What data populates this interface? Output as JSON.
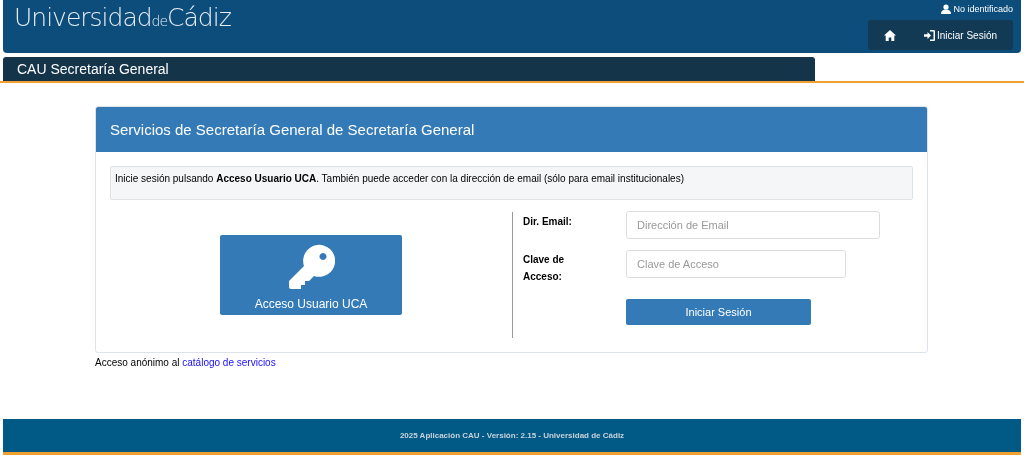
{
  "header": {
    "logo": [
      "Universidad",
      "de",
      "Cádiz"
    ],
    "user_status": "No identificado",
    "nav": [
      {
        "kind": "home"
      },
      {
        "kind": "login",
        "label": "Iniciar Sesión"
      }
    ]
  },
  "section_title": "CAU Secretaría General",
  "panel": {
    "title": "Servicios de Secretaría General de Secretaría General",
    "notice": "Inicie sesión pulsando **Acceso Usuario UCA**. También puede acceder con la dirección de email (sólo para email institucionales)",
    "sso_button": "Acceso Usuario UCA",
    "form": {
      "fields": [
        {
          "label": "Dir. Email:",
          "placeholder": "Dirección de Email",
          "kind": "email"
        },
        {
          "label": "Clave de Acceso:",
          "placeholder": "Clave de Acceso",
          "kind": "password"
        }
      ],
      "submit": "Iniciar Sesión"
    }
  },
  "anonymous": {
    "text": "Acceso anónimo al",
    "link": "catálogo de servicios"
  },
  "footer": "2025 Aplicación CAU - Versión: 2.15 - Universidad de Cádiz"
}
